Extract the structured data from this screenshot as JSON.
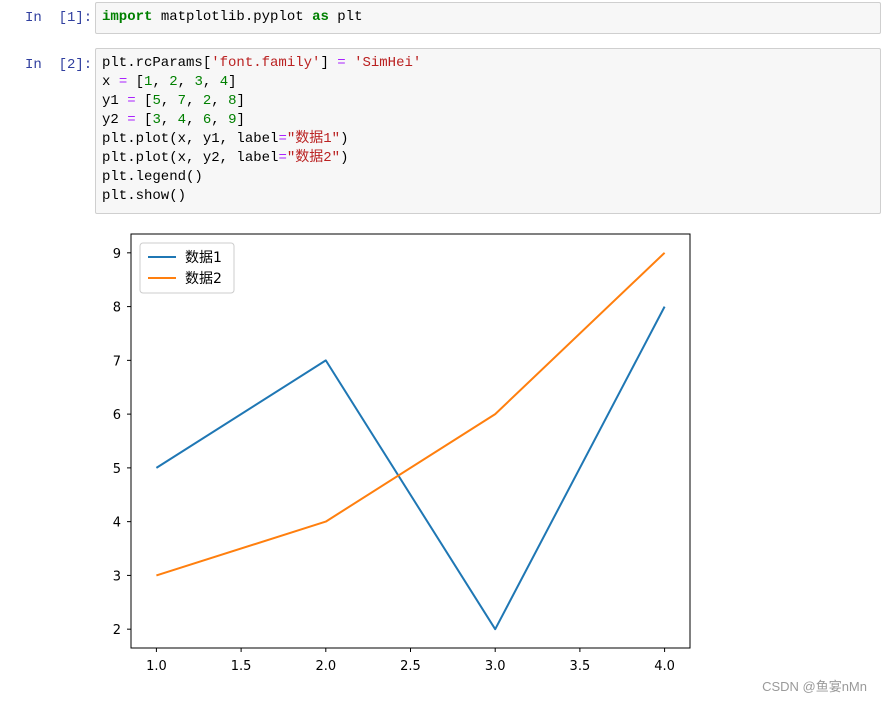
{
  "cells": [
    {
      "prompt": "In  [1]:",
      "lines": [
        [
          {
            "t": "import",
            "c": "kw"
          },
          {
            "t": " matplotlib.pyplot ",
            "c": ""
          },
          {
            "t": "as",
            "c": "kw"
          },
          {
            "t": " plt",
            "c": ""
          }
        ]
      ]
    },
    {
      "prompt": "In  [2]:",
      "lines": [
        [
          {
            "t": "plt.rcParams[",
            "c": ""
          },
          {
            "t": "'font.family'",
            "c": "str"
          },
          {
            "t": "] ",
            "c": ""
          },
          {
            "t": "=",
            "c": "op"
          },
          {
            "t": " ",
            "c": ""
          },
          {
            "t": "'SimHei'",
            "c": "str"
          }
        ],
        [
          {
            "t": "x ",
            "c": ""
          },
          {
            "t": "=",
            "c": "op"
          },
          {
            "t": " [",
            "c": ""
          },
          {
            "t": "1",
            "c": "num"
          },
          {
            "t": ", ",
            "c": ""
          },
          {
            "t": "2",
            "c": "num"
          },
          {
            "t": ", ",
            "c": ""
          },
          {
            "t": "3",
            "c": "num"
          },
          {
            "t": ", ",
            "c": ""
          },
          {
            "t": "4",
            "c": "num"
          },
          {
            "t": "]",
            "c": ""
          }
        ],
        [
          {
            "t": "y1 ",
            "c": ""
          },
          {
            "t": "=",
            "c": "op"
          },
          {
            "t": " [",
            "c": ""
          },
          {
            "t": "5",
            "c": "num"
          },
          {
            "t": ", ",
            "c": ""
          },
          {
            "t": "7",
            "c": "num"
          },
          {
            "t": ", ",
            "c": ""
          },
          {
            "t": "2",
            "c": "num"
          },
          {
            "t": ", ",
            "c": ""
          },
          {
            "t": "8",
            "c": "num"
          },
          {
            "t": "]",
            "c": ""
          }
        ],
        [
          {
            "t": "y2 ",
            "c": ""
          },
          {
            "t": "=",
            "c": "op"
          },
          {
            "t": " [",
            "c": ""
          },
          {
            "t": "3",
            "c": "num"
          },
          {
            "t": ", ",
            "c": ""
          },
          {
            "t": "4",
            "c": "num"
          },
          {
            "t": ", ",
            "c": ""
          },
          {
            "t": "6",
            "c": "num"
          },
          {
            "t": ", ",
            "c": ""
          },
          {
            "t": "9",
            "c": "num"
          },
          {
            "t": "]",
            "c": ""
          }
        ],
        [
          {
            "t": "plt.plot(x, y1, label",
            "c": ""
          },
          {
            "t": "=",
            "c": "op"
          },
          {
            "t": "\"数据1\"",
            "c": "str"
          },
          {
            "t": ")",
            "c": ""
          }
        ],
        [
          {
            "t": "plt.plot(x, y2, label",
            "c": ""
          },
          {
            "t": "=",
            "c": "op"
          },
          {
            "t": "\"数据2\"",
            "c": "str"
          },
          {
            "t": ")",
            "c": ""
          }
        ],
        [
          {
            "t": "plt.legend()",
            "c": ""
          }
        ],
        [
          {
            "t": "plt.show()",
            "c": ""
          }
        ]
      ]
    }
  ],
  "chart_data": {
    "type": "line",
    "x": [
      1,
      2,
      3,
      4
    ],
    "series": [
      {
        "name": "数据1",
        "values": [
          5,
          7,
          2,
          8
        ],
        "color": "#1f77b4"
      },
      {
        "name": "数据2",
        "values": [
          3,
          4,
          6,
          9
        ],
        "color": "#ff7f0e"
      }
    ],
    "xticks": [
      "1.0",
      "1.5",
      "2.0",
      "2.5",
      "3.0",
      "3.5",
      "4.0"
    ],
    "yticks": [
      "2",
      "3",
      "4",
      "5",
      "6",
      "7",
      "8",
      "9"
    ],
    "xlim": [
      0.85,
      4.15
    ],
    "ylim": [
      1.65,
      9.35
    ],
    "legend": "upper left",
    "grid": false
  },
  "watermark": "CSDN @鱼宴nMn"
}
